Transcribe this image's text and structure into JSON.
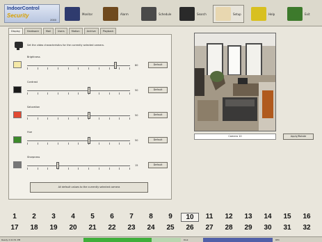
{
  "app": {
    "logo": {
      "line1": "IndoorControl",
      "line2": "Security",
      "line3": "2000"
    }
  },
  "toolbar": {
    "items": [
      {
        "label": "Monitor",
        "icon": "monitor-icon",
        "color": "#2f3b6e"
      },
      {
        "label": "Alarm",
        "icon": "alarm-icon",
        "color": "#6f4a1e"
      },
      {
        "label": "Schedule",
        "icon": "schedule-icon",
        "color": "#4a4a4a"
      },
      {
        "label": "Search",
        "icon": "search-binoculars-icon",
        "color": "#2a2a2a"
      },
      {
        "label": "Setup",
        "icon": "setup-hand-icon",
        "color": "#e8d7b0",
        "active": true
      },
      {
        "label": "Help",
        "icon": "help-icon",
        "color": "#d8c020"
      },
      {
        "label": "Exit",
        "icon": "exit-icon",
        "color": "#3d7a2c"
      }
    ]
  },
  "tabs": [
    "Display",
    "Hardware",
    "Mail",
    "Users",
    "Motion",
    "Archive",
    "Playback"
  ],
  "settings": {
    "hint": "Set the video characteristics for the currently selected camera.",
    "rows": [
      {
        "label": "Brightness",
        "value": "80",
        "level": 0.86,
        "button": "Default",
        "swatch": "#f5e9a8"
      },
      {
        "label": "Contrast",
        "value": "50",
        "level": 0.6,
        "button": "Default",
        "swatch": "#1a1a1a"
      },
      {
        "label": "Saturation",
        "value": "50",
        "level": 0.6,
        "button": "Default",
        "swatch": "#e24a32"
      },
      {
        "label": "Hue",
        "value": "50",
        "level": 0.6,
        "button": "Default",
        "swatch": "#3c8a2a"
      },
      {
        "label": "Sharpness",
        "value": "15",
        "level": 0.3,
        "button": "Default",
        "swatch": "#777777"
      }
    ],
    "reset_all": "All default values to the currently selected camera"
  },
  "video": {
    "caption": "Camera 10",
    "update_button": "Apply/Rotate"
  },
  "cameras": {
    "row1": [
      "1",
      "2",
      "3",
      "4",
      "5",
      "6",
      "7",
      "8",
      "9",
      "10",
      "11",
      "12",
      "13",
      "14",
      "15",
      "16"
    ],
    "row2": [
      "17",
      "18",
      "19",
      "20",
      "21",
      "22",
      "23",
      "24",
      "25",
      "26",
      "27",
      "28",
      "29",
      "30",
      "31",
      "32"
    ],
    "selected": "10"
  },
  "statusbar": {
    "left": "Ready  2:41:51 PM",
    "mid": "Disk",
    "right": "REC"
  }
}
